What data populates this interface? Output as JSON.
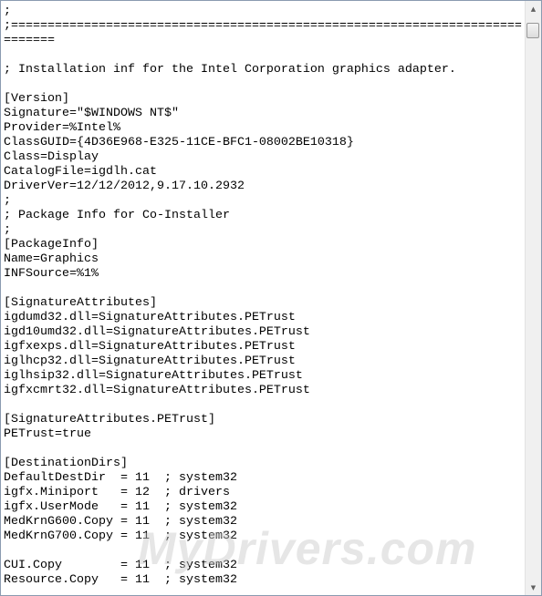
{
  "editor": {
    "lines": [
      ";",
      ";======================================================================",
      "=======",
      "",
      "; Installation inf for the Intel Corporation graphics adapter.",
      "",
      "[Version]",
      "Signature=\"$WINDOWS NT$\"",
      "Provider=%Intel%",
      "ClassGUID={4D36E968-E325-11CE-BFC1-08002BE10318}",
      "Class=Display",
      "CatalogFile=igdlh.cat",
      "DriverVer=12/12/2012,9.17.10.2932",
      ";",
      "; Package Info for Co-Installer",
      ";",
      "[PackageInfo]",
      "Name=Graphics",
      "INFSource=%1%",
      "",
      "[SignatureAttributes]",
      "igdumd32.dll=SignatureAttributes.PETrust",
      "igd10umd32.dll=SignatureAttributes.PETrust",
      "igfxexps.dll=SignatureAttributes.PETrust",
      "iglhcp32.dll=SignatureAttributes.PETrust",
      "iglhsip32.dll=SignatureAttributes.PETrust",
      "igfxcmrt32.dll=SignatureAttributes.PETrust",
      "",
      "[SignatureAttributes.PETrust]",
      "PETrust=true",
      "",
      "[DestinationDirs]",
      "DefaultDestDir  = 11  ; system32",
      "igfx.Miniport   = 12  ; drivers",
      "igfx.UserMode   = 11  ; system32",
      "MedKrnG600.Copy = 11  ; system32",
      "MedKrnG700.Copy = 11  ; system32",
      "",
      "CUI.Copy        = 11  ; system32",
      "Resource.Copy   = 11  ; system32"
    ]
  },
  "scrollbar": {
    "up_icon": "scroll-up-arrow",
    "down_icon": "scroll-down-arrow",
    "up_glyph": "▲",
    "down_glyph": "▼",
    "position": 0.0
  },
  "watermark": "MyDrivers.com"
}
